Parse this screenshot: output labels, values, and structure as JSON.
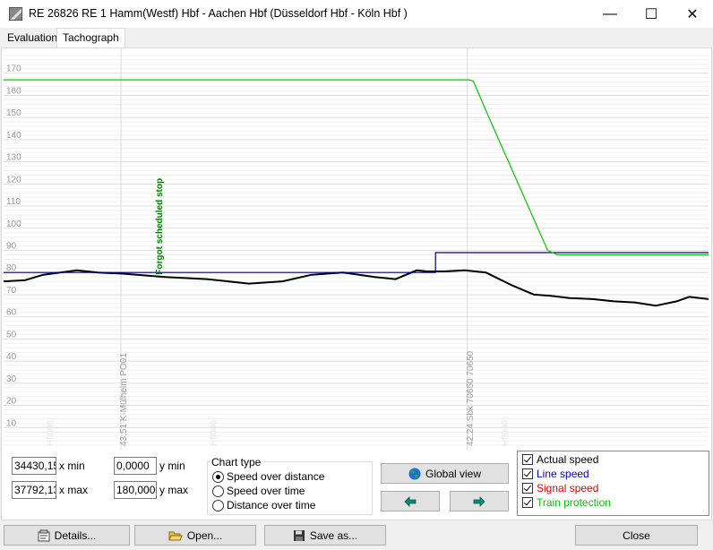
{
  "window": {
    "title": "RE 26826 RE 1 Hamm(Westf) Hbf - Aachen Hbf (Düsseldorf Hbf - Köln Hbf )",
    "minimize": "—",
    "maximize": "☐",
    "close": "✕"
  },
  "tabs": [
    {
      "label": "Evaluation",
      "active": false
    },
    {
      "label": "Tachograph",
      "active": true
    }
  ],
  "chart_data": {
    "type": "line",
    "xlim": [
      34430.15,
      37792.13
    ],
    "ylim": [
      0,
      180
    ],
    "yticks": [
      10,
      20,
      30,
      40,
      50,
      60,
      70,
      80,
      90,
      100,
      110,
      120,
      130,
      140,
      150,
      160,
      170
    ],
    "grid": true,
    "series": [
      {
        "name": "Actual speed",
        "color": "#000000",
        "x": [
          34430,
          34530,
          34620,
          34780,
          34880,
          35000,
          35200,
          35400,
          35600,
          35760,
          35900,
          36050,
          36200,
          36300,
          36400,
          36450,
          36530,
          36630,
          36730,
          36860,
          36960,
          37040,
          37130,
          37240,
          37340,
          37440,
          37540,
          37640,
          37700,
          37792
        ],
        "y": [
          76,
          76.5,
          79,
          81,
          80,
          79.5,
          78,
          77,
          75,
          76,
          79,
          80,
          78,
          77,
          81,
          80.5,
          80.5,
          81,
          80,
          74,
          70,
          69.5,
          68.5,
          68,
          67,
          66.5,
          65,
          67,
          69,
          68
        ]
      },
      {
        "name": "Line speed",
        "color": "#00007f",
        "x": [
          34430,
          36490,
          36490,
          37792
        ],
        "y": [
          80,
          80,
          89,
          89
        ]
      },
      {
        "name": "Train protection",
        "color": "#00c800",
        "x": [
          34430,
          36650,
          36670,
          36745,
          37025,
          37072,
          37792
        ],
        "y": [
          167,
          167,
          166.5,
          150,
          90,
          88,
          88
        ]
      }
    ],
    "markers": [
      {
        "x": 34990,
        "label": "43.51 K-Mülheim PO01"
      },
      {
        "x": 36642,
        "label": "42.24 Sbk 70650 70650"
      },
      {
        "x": 35170,
        "label": "Forgot scheduled stop",
        "color": "#008000",
        "y": 100
      }
    ],
    "faded_labels": [
      {
        "x": 34640,
        "label": "Hfl000"
      },
      {
        "x": 35420,
        "label": "Hfl000"
      },
      {
        "x": 36810,
        "label": "Hfl000"
      }
    ]
  },
  "controls": {
    "x_min": "34430,15",
    "x_min_label": "x min",
    "x_max": "37792,13",
    "x_max_label": "x max",
    "y_min": "0,0000",
    "y_min_label": "y min",
    "y_max": "180,0000",
    "y_max_label": "y max"
  },
  "chart_type": {
    "title": "Chart type",
    "options": [
      "Speed over distance",
      "Speed over time",
      "Distance over time"
    ],
    "selected": "Speed over distance"
  },
  "nav": {
    "global_view": "Global view"
  },
  "legend": [
    {
      "label": "Actual speed",
      "color": "#000000",
      "checked": true
    },
    {
      "label": "Line speed",
      "color": "#0000c8",
      "checked": true
    },
    {
      "label": "Signal speed",
      "color": "#e00000",
      "checked": true
    },
    {
      "label": "Train protection",
      "color": "#00c800",
      "checked": true
    }
  ],
  "bottom_buttons": {
    "details": "Details...",
    "open": "Open...",
    "save_as": "Save as...",
    "close": "Close"
  }
}
